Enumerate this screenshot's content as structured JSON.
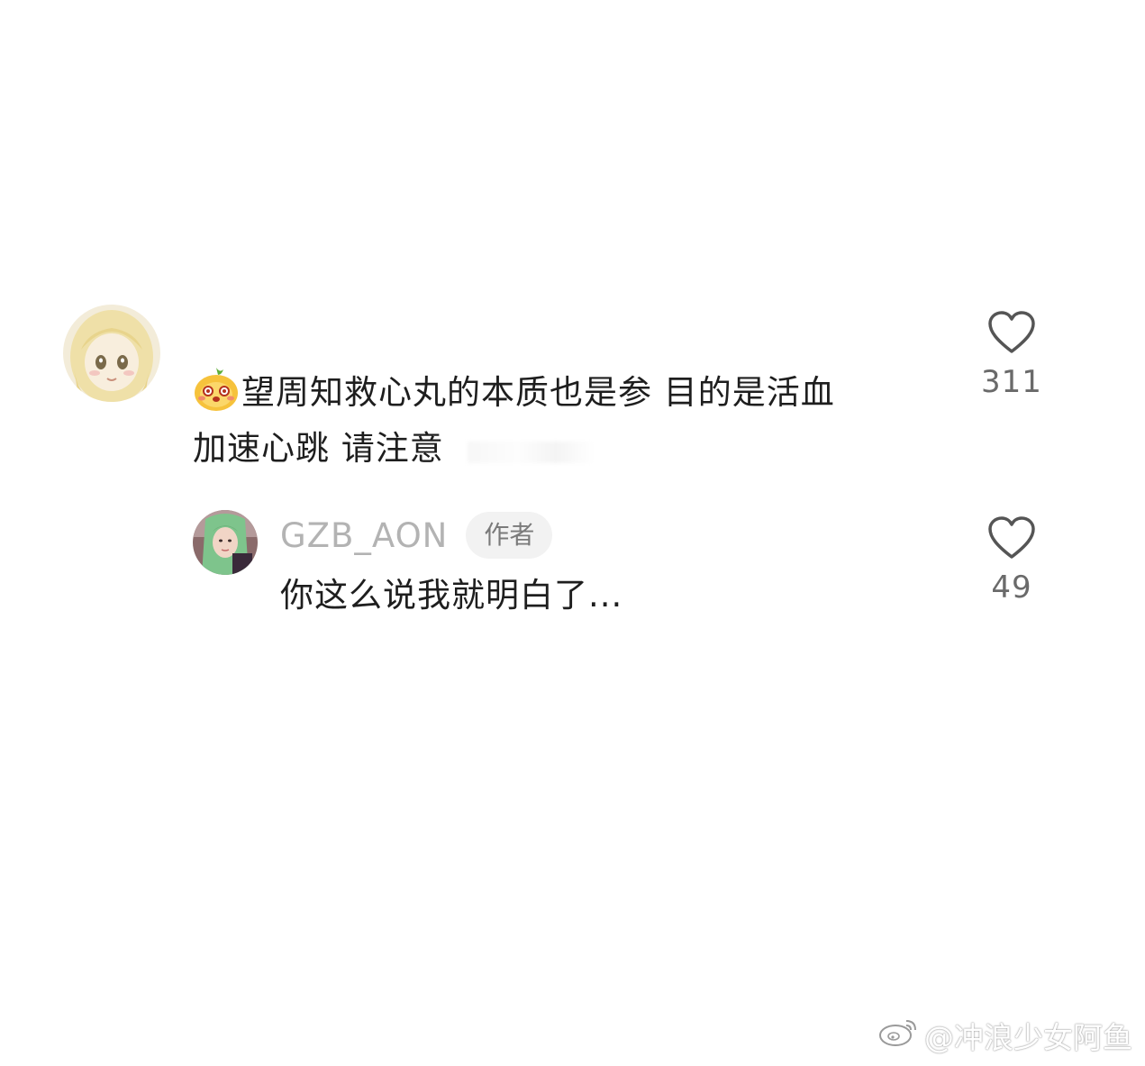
{
  "comment": {
    "avatar_icon": "blonde-girl-avatar",
    "emoji_icon": "yellow-blushing-face-emoji",
    "line1": "望周知救心丸的本质也是参 目的是活血",
    "line2": "加速心跳 请注意",
    "likes": "311"
  },
  "reply": {
    "avatar_icon": "green-hair-avatar",
    "username": "GZB_AON",
    "badge": "作者",
    "text": "你这么说我就明白了...",
    "likes": "49"
  },
  "watermark": {
    "icon": "weibo-logo-icon",
    "text": "@冲浪少女阿鱼"
  },
  "colors": {
    "background": "#ffffff",
    "text": "#1e1e1e",
    "username": "#b3b3b3",
    "badge_bg": "#f2f2f2",
    "like_count": "#6a6a6a"
  }
}
